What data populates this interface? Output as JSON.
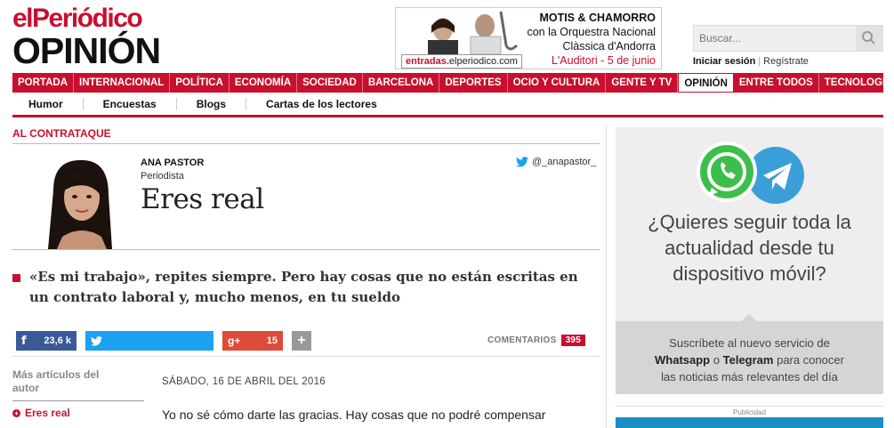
{
  "header": {
    "logo_top": "elPeriódico",
    "logo_bottom": "OPINIÓN"
  },
  "ad": {
    "url_prefix": "entradas.",
    "url_rest": "elperiodico.com",
    "line1": "MOTIS & CHAMORRO",
    "line2": "con la Orquestra Nacional",
    "line3": "Clàssica d'Andorra",
    "line4": "L'Auditori - 5 de junio"
  },
  "search": {
    "placeholder": "Buscar..."
  },
  "login": {
    "signin": "Iniciar sesión",
    "sep": "|",
    "register": "Regístrate"
  },
  "nav": {
    "items": [
      "PORTADA",
      "INTERNACIONAL",
      "POLÍTICA",
      "ECONOMÍA",
      "SOCIEDAD",
      "BARCELONA",
      "DEPORTES",
      "OCIO Y CULTURA",
      "GENTE Y TV",
      "OPINIÓN",
      "ENTRE TODOS",
      "TECNOLOGÍA"
    ],
    "active": "OPINIÓN"
  },
  "subnav": {
    "items": [
      "Humor",
      "Encuestas",
      "Blogs",
      "Cartas de los lectores"
    ]
  },
  "article": {
    "section": "AL CONTRATAQUE",
    "author": "ANA PASTOR",
    "role": "Periodista",
    "twitter": "@_anapastor_",
    "title": "Eres real",
    "lead": "«Es mi trabajo», repites siempre. Pero hay cosas que no están escritas en un contrato laboral y, mucho menos, en tu sueldo",
    "date": "SÁBADO, 16 DE ABRIL DEL 2016",
    "body_start": "Yo no sé cómo darte las gracias. Hay cosas que no podré compensar"
  },
  "share": {
    "facebook_count": "23,6 k",
    "gplus_count": "15",
    "comments_label": "COMENTARIOS",
    "comments_count": "395"
  },
  "more": {
    "title": "Más artículos del autor",
    "item": "Eres real"
  },
  "sidebar_ad": {
    "question": "¿Quieres seguir toda la actualidad desde tu dispositivo móvil?",
    "sub_pre": "Suscríbete al nuevo servicio de",
    "whatsapp": "Whatsapp",
    "o": "o",
    "telegram": "Telegram",
    "sub_mid": "para conocer",
    "sub_end": "las noticias más relevantes del día"
  },
  "publicidad": "Publicidad",
  "colors": {
    "brand_red": "#c8102e",
    "facebook": "#3b5998",
    "twitter": "#1da1f2",
    "gplus": "#dd4b39"
  }
}
